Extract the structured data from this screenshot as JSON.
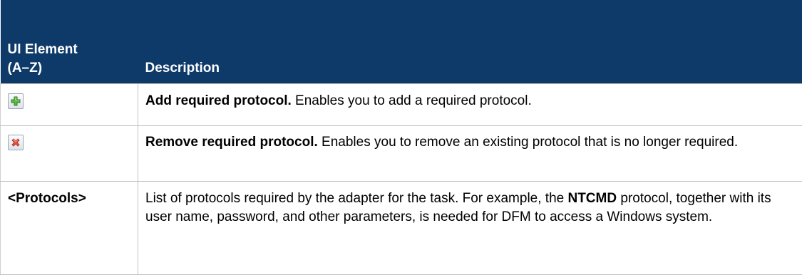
{
  "header": {
    "col1_line1": "UI Element",
    "col1_line2": "(A–Z)",
    "col2": "Description"
  },
  "rows": [
    {
      "icon": "add-icon",
      "lead": "Add required protocol.",
      "text": " Enables you to add a required protocol."
    },
    {
      "icon": "remove-icon",
      "lead": "Remove required protocol.",
      "text": " Enables you to remove an existing protocol that is no longer required."
    },
    {
      "element": "<Protocols>",
      "text_before": "List of protocols required by the adapter for the task. For example, the ",
      "bold": "NTCMD",
      "text_after": " protocol, together with its user name, password, and other parameters, is needed for DFM to access a Windows system."
    }
  ],
  "colors": {
    "header_bg": "#0e3a69",
    "header_text": "#ffffff",
    "border": "#bfbfbf",
    "add_icon": "#4caf3a",
    "remove_icon": "#e0402a"
  }
}
